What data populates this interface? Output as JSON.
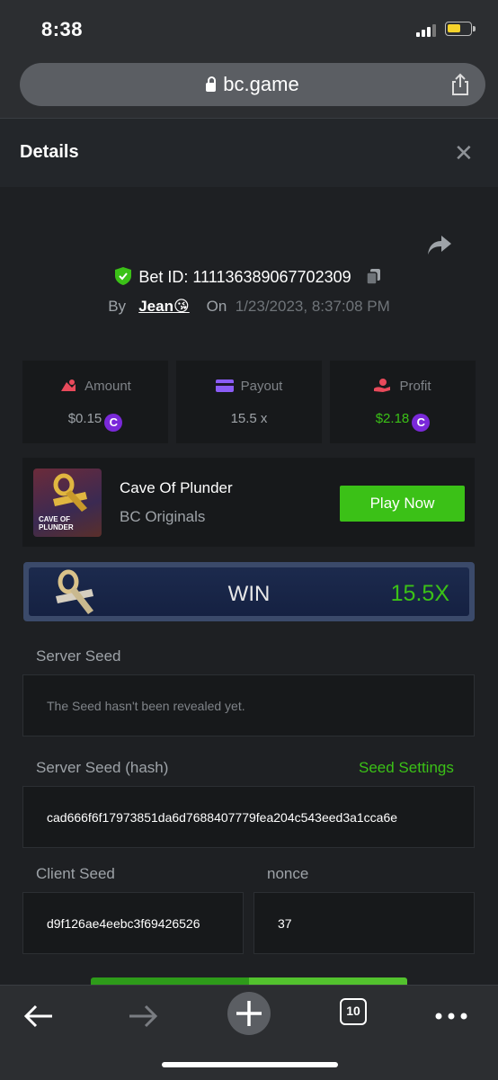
{
  "status_bar": {
    "time": "8:38"
  },
  "browser": {
    "url": "bc.game"
  },
  "details": {
    "title": "Details",
    "close_label": "✕",
    "bet_id_label": "Bet ID:",
    "bet_id": "111136389067702309",
    "by_label": "By",
    "user": "Jean😘",
    "on_label": "On",
    "date": "1/23/2023, 8:37:08 PM"
  },
  "stats": [
    {
      "label": "Amount",
      "value": "$0.15",
      "color": "#9ea3a8",
      "icon": "coin-stack-icon"
    },
    {
      "label": "Payout",
      "value": "15.5 x",
      "color": "#9ea3a8",
      "icon": "wallet-icon"
    },
    {
      "label": "Profit",
      "value": "$2.18",
      "color": "#3bc117",
      "icon": "hand-coin-icon"
    }
  ],
  "game": {
    "thumb_text": "CAVE OF\nPLUNDER",
    "name": "Cave Of Plunder",
    "provider": "BC Originals",
    "play_label": "Play Now"
  },
  "result": {
    "label": "WIN",
    "multiplier": "15.5X"
  },
  "seeds": {
    "server_seed_label": "Server Seed",
    "server_seed_value": "The Seed hasn't been revealed yet.",
    "server_hash_label": "Server Seed (hash)",
    "seed_settings_label": "Seed Settings",
    "server_hash_value": "cad666f6f17973851da6d7688407779fea204c543eed3a1cca6e",
    "client_seed_label": "Client Seed",
    "client_seed_value": "d9f126ae4eebc3f69426526",
    "nonce_label": "nonce",
    "nonce_value": "37"
  },
  "toolbar": {
    "tabs_count": "10"
  },
  "colors": {
    "accent_green": "#3bc117",
    "coin_purple": "#7a29d9",
    "background": "#1e2023"
  }
}
